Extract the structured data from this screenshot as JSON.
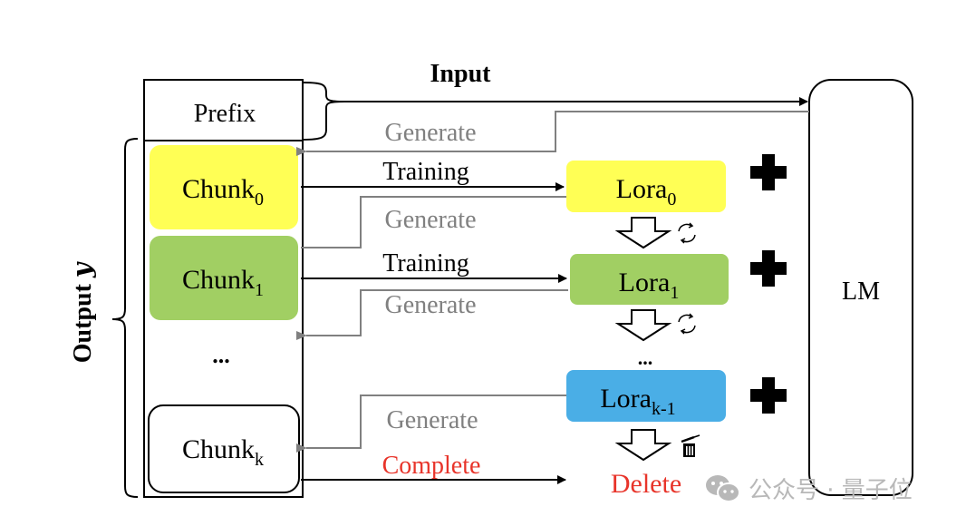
{
  "title": "Input",
  "output_label": "Output",
  "output_var": "y",
  "model_label": "LM",
  "prefix_label": "Prefix",
  "chunks": [
    {
      "base": "Chunk",
      "sub": "0",
      "color": "#ffff55"
    },
    {
      "base": "Chunk",
      "sub": "1",
      "color": "#a1cf63"
    },
    {
      "base": "Chunk",
      "sub": "k",
      "color": "#ffffff"
    }
  ],
  "ellipsis": "...",
  "loras": [
    {
      "base": "Lora",
      "sub": "0",
      "color": "#ffff55"
    },
    {
      "base": "Lora",
      "sub": "1",
      "color": "#a1cf63"
    },
    {
      "base": "Lora",
      "sub": "k-1",
      "color": "#4aaee6"
    }
  ],
  "edges": {
    "training": "Training",
    "generate": "Generate",
    "complete": "Complete",
    "delete": "Delete"
  },
  "colors": {
    "generate": "#808080",
    "complete": "#e8342a",
    "delete": "#e8342a"
  },
  "icons": [
    "plus-icon",
    "refresh-icon",
    "trash-icon"
  ],
  "watermark": "公众号 · 量子位"
}
